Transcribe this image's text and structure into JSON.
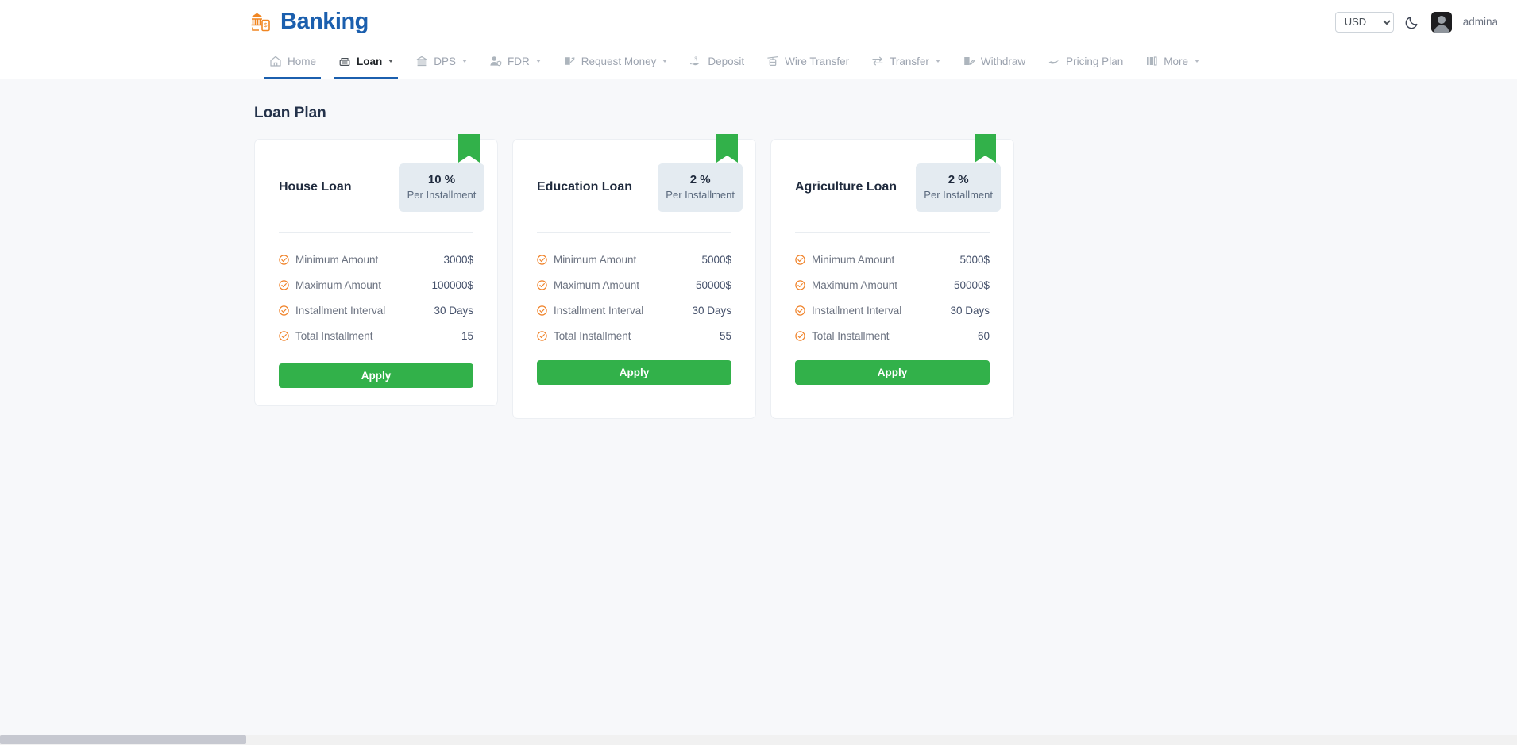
{
  "header": {
    "brand": "Banking",
    "brand_icon": "bank-phone-icon",
    "currency": "USD",
    "currency_options": [
      "USD"
    ],
    "theme_toggle_icon": "moon-icon",
    "avatar_icon": "user-avatar",
    "username": "admina",
    "accent_color": "#1b5fae",
    "logo_icon_color": "#f08622"
  },
  "nav": {
    "items": [
      {
        "label": "Home",
        "icon": "home-icon",
        "active": false,
        "caret": false
      },
      {
        "label": "Loan",
        "icon": "loan-icon",
        "active": true,
        "caret": true
      },
      {
        "label": "DPS",
        "icon": "bank-icon",
        "active": false,
        "caret": true
      },
      {
        "label": "FDR",
        "icon": "user-shield-icon",
        "active": false,
        "caret": true
      },
      {
        "label": "Request Money",
        "icon": "request-money-icon",
        "active": false,
        "caret": true
      },
      {
        "label": "Deposit",
        "icon": "hand-dollar-icon",
        "active": false,
        "caret": false
      },
      {
        "label": "Wire Transfer",
        "icon": "cable-car-icon",
        "active": false,
        "caret": false
      },
      {
        "label": "Transfer",
        "icon": "exchange-arrows-icon",
        "active": false,
        "caret": true
      },
      {
        "label": "Withdraw",
        "icon": "pen-square-icon",
        "active": false,
        "caret": false
      },
      {
        "label": "Pricing Plan",
        "icon": "swoosh-icon",
        "active": false,
        "caret": false
      },
      {
        "label": "More",
        "icon": "columns-icon",
        "active": false,
        "caret": true
      }
    ]
  },
  "page": {
    "title": "Loan Plan"
  },
  "cards": [
    {
      "title": "House Loan",
      "rate": "10 %",
      "rate_label": "Per Installment",
      "ribbon_color": "#32b14a",
      "features": [
        {
          "label": "Minimum Amount",
          "value": "3000$"
        },
        {
          "label": "Maximum Amount",
          "value": "100000$"
        },
        {
          "label": "Installment Interval",
          "value": "30 Days"
        },
        {
          "label": "Total Installment",
          "value": "15"
        }
      ],
      "apply_label": "Apply"
    },
    {
      "title": "Education Loan",
      "rate": "2 %",
      "rate_label": "Per Installment",
      "ribbon_color": "#32b14a",
      "features": [
        {
          "label": "Minimum Amount",
          "value": "5000$"
        },
        {
          "label": "Maximum Amount",
          "value": "50000$"
        },
        {
          "label": "Installment Interval",
          "value": "30 Days"
        },
        {
          "label": "Total Installment",
          "value": "55"
        }
      ],
      "apply_label": "Apply"
    },
    {
      "title": "Agriculture Loan",
      "rate": "2 %",
      "rate_label": "Per Installment",
      "ribbon_color": "#32b14a",
      "features": [
        {
          "label": "Minimum Amount",
          "value": "5000$"
        },
        {
          "label": "Maximum Amount",
          "value": "50000$"
        },
        {
          "label": "Installment Interval",
          "value": "30 Days"
        },
        {
          "label": "Total Installment",
          "value": "60"
        }
      ],
      "apply_label": "Apply"
    }
  ]
}
